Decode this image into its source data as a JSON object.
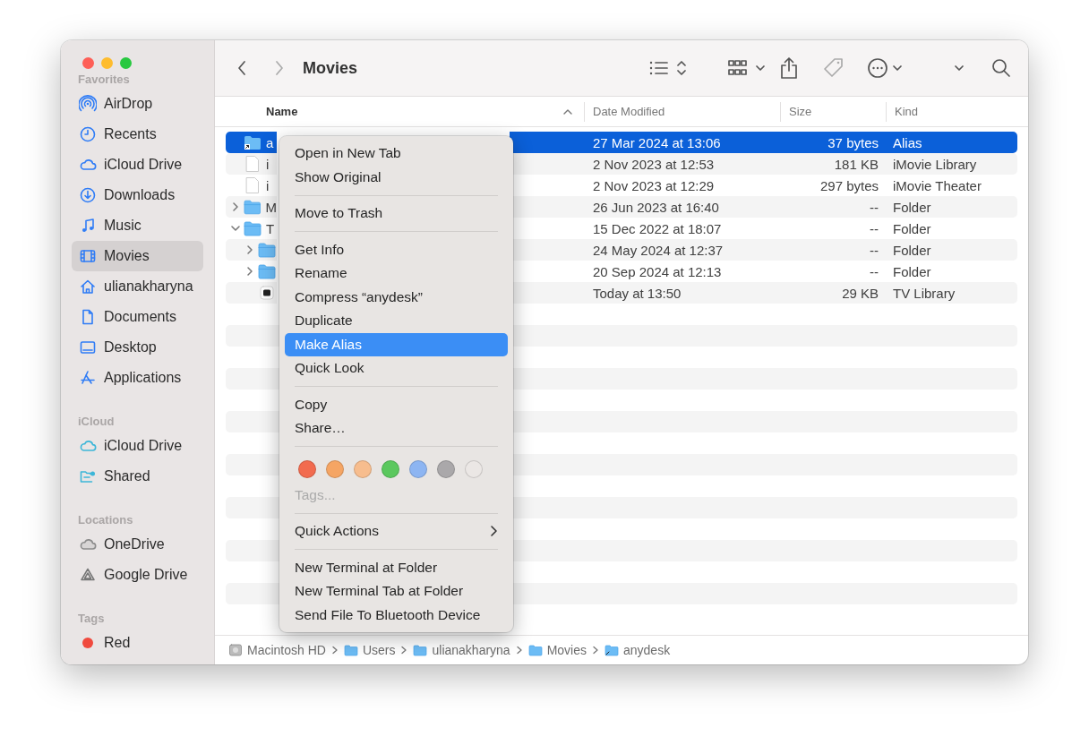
{
  "window": {
    "title": "Movies"
  },
  "sidebar": {
    "sections": [
      {
        "heading": "Favorites",
        "items": [
          {
            "label": "AirDrop",
            "selected": false
          },
          {
            "label": "Recents",
            "selected": false
          },
          {
            "label": "iCloud Drive",
            "selected": false
          },
          {
            "label": "Downloads",
            "selected": false
          },
          {
            "label": "Music",
            "selected": false
          },
          {
            "label": "Movies",
            "selected": true
          },
          {
            "label": "ulianakharyna",
            "selected": false
          },
          {
            "label": "Documents",
            "selected": false
          },
          {
            "label": "Desktop",
            "selected": false
          },
          {
            "label": "Applications",
            "selected": false
          }
        ]
      },
      {
        "heading": "iCloud",
        "items": [
          {
            "label": "iCloud Drive",
            "selected": false
          },
          {
            "label": "Shared",
            "selected": false
          }
        ]
      },
      {
        "heading": "Locations",
        "items": [
          {
            "label": "OneDrive",
            "selected": false
          },
          {
            "label": "Google Drive",
            "selected": false
          }
        ]
      },
      {
        "heading": "Tags",
        "items": [
          {
            "label": "Red",
            "selected": false,
            "color": "#f04a3e"
          }
        ]
      }
    ]
  },
  "table": {
    "columns": [
      {
        "label": "Name",
        "sorted": true
      },
      {
        "label": "Date Modified",
        "sorted": false
      },
      {
        "label": "Size",
        "sorted": false
      },
      {
        "label": "Kind",
        "sorted": false
      }
    ],
    "rows": [
      {
        "kind": "alias",
        "name": "a",
        "date": "27 Mar 2024 at 13:06",
        "size": "37 bytes",
        "type": "Alias",
        "selected": true
      },
      {
        "kind": "file",
        "name": "i",
        "date": "2 Nov 2023 at 12:53",
        "size": "181 KB",
        "type": "iMovie Library",
        "selected": false
      },
      {
        "kind": "file",
        "name": "i",
        "date": "2 Nov 2023 at 12:29",
        "size": "297 bytes",
        "type": "iMovie Theater",
        "selected": false
      },
      {
        "kind": "folder",
        "name": "M",
        "date": "26 Jun 2023 at 16:40",
        "size": "--",
        "type": "Folder",
        "selected": false,
        "expanded": false
      },
      {
        "kind": "folder",
        "name": "T",
        "date": "15 Dec 2022 at 18:07",
        "size": "--",
        "type": "Folder",
        "selected": false,
        "expanded": true,
        "children": [
          {
            "kind": "folder",
            "date": "24 May 2024 at 12:37",
            "size": "--",
            "type": "Folder",
            "selected": false,
            "expanded": false
          },
          {
            "kind": "folder",
            "date": "20 Sep 2024 at 12:13",
            "size": "--",
            "type": "Folder",
            "selected": false,
            "expanded": false
          },
          {
            "kind": "app",
            "date": "Today at 13:50",
            "size": "29 KB",
            "type": "TV Library",
            "selected": false
          }
        ]
      }
    ]
  },
  "context_menu": {
    "items": [
      {
        "kind": "item",
        "label": "Open in New Tab",
        "selected": false
      },
      {
        "kind": "item",
        "label": "Show Original",
        "selected": false
      },
      {
        "kind": "separator"
      },
      {
        "kind": "item",
        "label": "Move to Trash",
        "selected": false
      },
      {
        "kind": "separator"
      },
      {
        "kind": "item",
        "label": "Get Info",
        "selected": false
      },
      {
        "kind": "item",
        "label": "Rename",
        "selected": false
      },
      {
        "kind": "item",
        "label": "Compress “anydesk”",
        "selected": false
      },
      {
        "kind": "item",
        "label": "Duplicate",
        "selected": false
      },
      {
        "kind": "item",
        "label": "Make Alias",
        "selected": true
      },
      {
        "kind": "item",
        "label": "Quick Look",
        "selected": false
      },
      {
        "kind": "separator"
      },
      {
        "kind": "item",
        "label": "Copy",
        "selected": false
      },
      {
        "kind": "item",
        "label": "Share…",
        "selected": false
      },
      {
        "kind": "separator"
      },
      {
        "kind": "tags",
        "colors": [
          {
            "color": "#f26b4f"
          },
          {
            "color": "#f5a564"
          },
          {
            "color": "#f7bd8e"
          },
          {
            "color": "#5bc85e"
          },
          {
            "color": "#8db5f2"
          },
          {
            "color": "#aaa8aa"
          },
          {
            "color": "#ebe7e5"
          }
        ]
      },
      {
        "kind": "placeholder",
        "label": "Tags..."
      },
      {
        "kind": "separator"
      },
      {
        "kind": "submenu",
        "label": "Quick Actions",
        "selected": false
      },
      {
        "kind": "separator"
      },
      {
        "kind": "item",
        "label": "New Terminal at Folder",
        "selected": false
      },
      {
        "kind": "item",
        "label": "New Terminal Tab at Folder",
        "selected": false
      },
      {
        "kind": "item",
        "label": "Send File To Bluetooth Device",
        "selected": false
      }
    ]
  },
  "path_bar": [
    {
      "kind": "disk",
      "label": "Macintosh HD"
    },
    {
      "kind": "folder",
      "label": "Users"
    },
    {
      "kind": "folder",
      "label": "ulianakharyna"
    },
    {
      "kind": "folder",
      "label": "Movies"
    },
    {
      "kind": "alias",
      "label": "anydesk"
    }
  ]
}
